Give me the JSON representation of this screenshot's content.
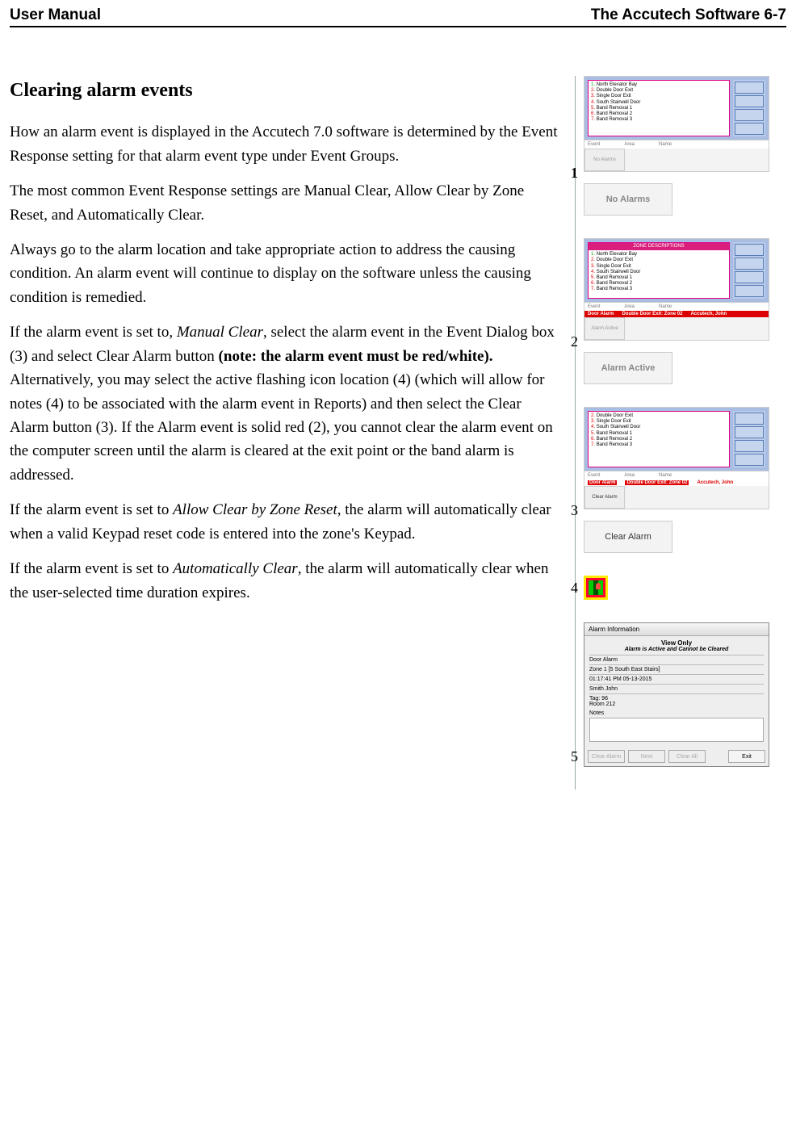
{
  "header": {
    "left": "User Manual",
    "right": "The Accutech Software 6-7"
  },
  "section_title": "Clearing alarm events",
  "paragraphs": {
    "p1": "How an alarm event is displayed in the Accutech 7.0 software is determined by the Event Response setting for that alarm event type under Event Groups.",
    "p2": "The most common Event Response settings are Manual Clear, Allow Clear by Zone Reset, and Automatically Clear.",
    "p3": "Always go to the alarm location and take appropriate action to address the causing condition. An alarm event will continue to display on the software unless the causing condition is remedied.",
    "p4_a": "If the alarm event is set to, ",
    "p4_i": "Manual Clear",
    "p4_b": ", select the alarm event in the Event Dialog box (3) and select Clear Alarm button ",
    "p4_bold": "(note: the alarm event must be red/white).",
    "p4_c": " Alternatively, you may select the active flashing icon location (4) (which will allow for notes (4) to be associated with the alarm event in Reports) and then select the Clear Alarm button (3). If the Alarm event is solid red (2), you cannot clear the alarm event on the computer screen until the alarm is cleared at the exit point or the band alarm is addressed.",
    "p5_a": "If the alarm event is set to ",
    "p5_i": "Allow Clear by Zone Reset",
    "p5_b": ", the alarm will automatically clear when a valid Keypad reset code is entered into the zone's Keypad.",
    "p6_a": "If the alarm event is set to ",
    "p6_i": "Automatically Clear",
    "p6_b": ", the alarm will automatically clear when the user-selected time duration expires."
  },
  "figures": {
    "zone_header": "ZONE DESCRIPTIONS",
    "zones": {
      "z1": "North Elevator Bay",
      "z2": "Double Door Exit",
      "z3": "Single Door Exit",
      "z4": "South Stairwell Door",
      "z5": "Band Removal 1",
      "z6": "Band Removal 2",
      "z7": "Band Removal 3"
    },
    "cols": {
      "event": "Event",
      "area": "Area",
      "name": "Name"
    },
    "fig1": {
      "num": "1",
      "btn": "No Alarms",
      "caption": "No Alarms"
    },
    "fig2": {
      "num": "2",
      "btn": "Alarm Active",
      "caption": "Alarm Active",
      "row": {
        "event": "Door Alarm",
        "area": "Double Door Exit: Zone 02",
        "name": "Accutech, John"
      }
    },
    "fig3": {
      "num": "3",
      "btn": "Clear Alarm",
      "caption": "Clear Alarm",
      "row": {
        "event": "Door Alarm",
        "area": "Double Door Exit: Zone 02",
        "name": "Accutech, John"
      }
    },
    "fig4": {
      "num": "4"
    },
    "fig5": {
      "num": "5",
      "title": "Alarm Information",
      "view_only": "View Only",
      "view_only_sub": "Alarm is Active and Cannot be Cleared",
      "l1": "Door Alarm",
      "l2": "Zone 1 [5 South East Stairs]",
      "l3": "01:17:41 PM  05-13-2015",
      "l4": "Smith John",
      "l5a": "Tag: 96",
      "l5b": "Room 212",
      "notes_label": "Notes",
      "btns": {
        "clear": "Clear Alarm",
        "next": "Next",
        "clear_all": "Clear All",
        "exit": "Exit"
      }
    }
  }
}
